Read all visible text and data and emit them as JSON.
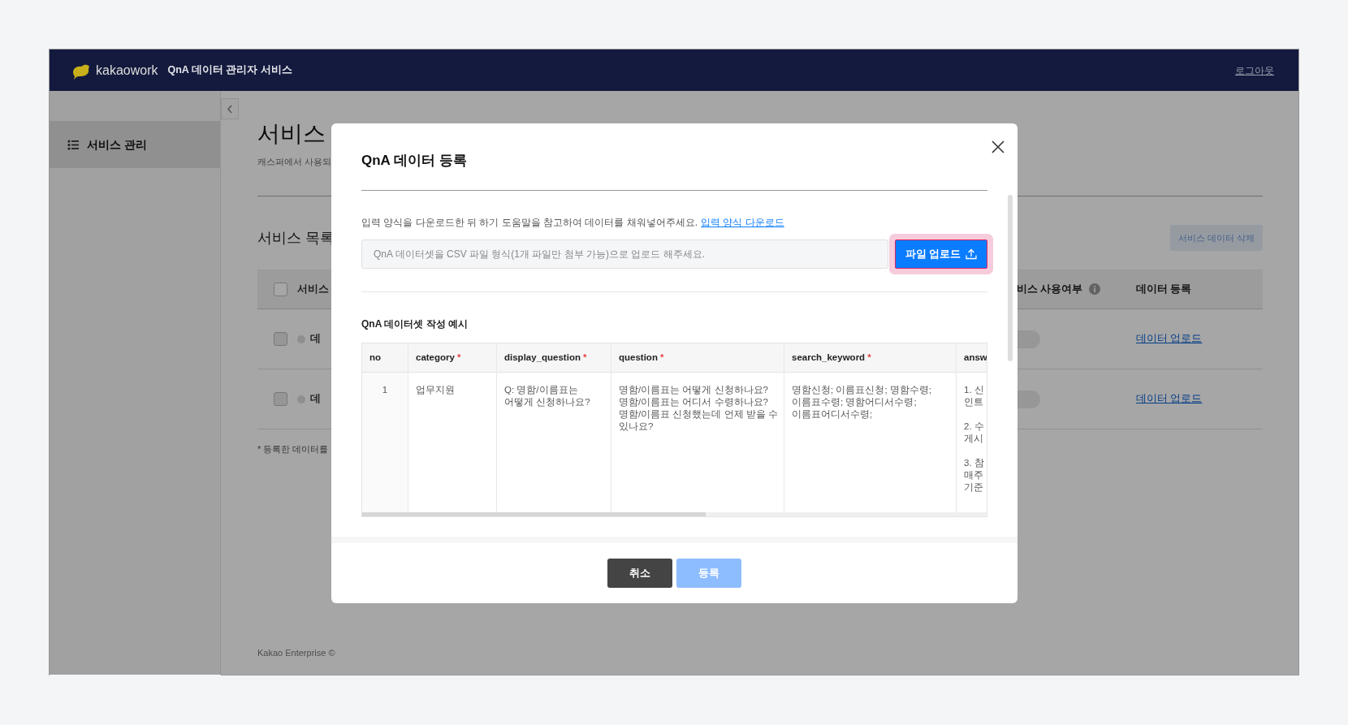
{
  "header": {
    "brand": "kakaowork",
    "title": "QnA 데이터 관리자 서비스",
    "logout": "로그아웃"
  },
  "sidebar": {
    "items": [
      {
        "label": "서비스 관리",
        "selected": true
      }
    ]
  },
  "page": {
    "title": "서비스",
    "subtitle": "캐스퍼에서 사용되",
    "section_title": "서비스 목록",
    "delete_button": {
      "label": "서비스 데이터 삭제",
      "disabled": true
    },
    "table": {
      "all_checked": false,
      "columns": [
        "서비스",
        "비스 사용여부",
        "데이터 등록"
      ],
      "rows": [
        {
          "checked": false,
          "name": "데",
          "on": false,
          "link": "데이터 업로드"
        },
        {
          "checked": false,
          "name": "데",
          "on": false,
          "link": "데이터 업로드"
        }
      ]
    },
    "note": "* 등록한 데이터를",
    "footer": "Kakao Enterprise ©"
  },
  "modal": {
    "title": "QnA 데이터 등록",
    "instruction": "입력 양식을 다운로드한 뒤 하기 도움말을 참고하여 데이터를 채워넣어주세요.",
    "download_link": "입력 양식 다운로드",
    "file_field": {
      "placeholder": "QnA 데이터셋을 CSV 파일 형식(1개 파일만 첨부 가능)으로 업로드 해주세요."
    },
    "upload_button": {
      "label": "파일 업로드",
      "focused": true
    },
    "example_title": "QnA 데이터셋 작성 예시",
    "example_table": {
      "columns": [
        {
          "label": "no"
        },
        {
          "label": "category",
          "mark": "*"
        },
        {
          "label": "display_question",
          "mark": "*"
        },
        {
          "label": "question",
          "mark": "*"
        },
        {
          "label": "search_keyword",
          "mark": "*"
        },
        {
          "label": "answ"
        }
      ],
      "rows": [
        [
          "1",
          "업무지원",
          "Q: 명함/이름표는\n어떻게 신청하나요?",
          "명함/이름표는 어떻게 신청하나요?\n명함/이름표는 어디서 수령하나요?\n명함/이름표 신청했는데 언제 받을 수\n있나요?",
          "명함신청; 이름표신청; 명함수령;\n이름표수령; 명함어디서수령;\n이름표어디서수령;",
          "1. 신\n인트\n\n2. 수\n게시\n\n3. 참\n매주\n기준"
        ]
      ]
    },
    "buttons": [
      {
        "label": "취소",
        "kind": "cancel",
        "disabled": false
      },
      {
        "label": "등록",
        "kind": "submit",
        "disabled": true
      }
    ]
  }
}
